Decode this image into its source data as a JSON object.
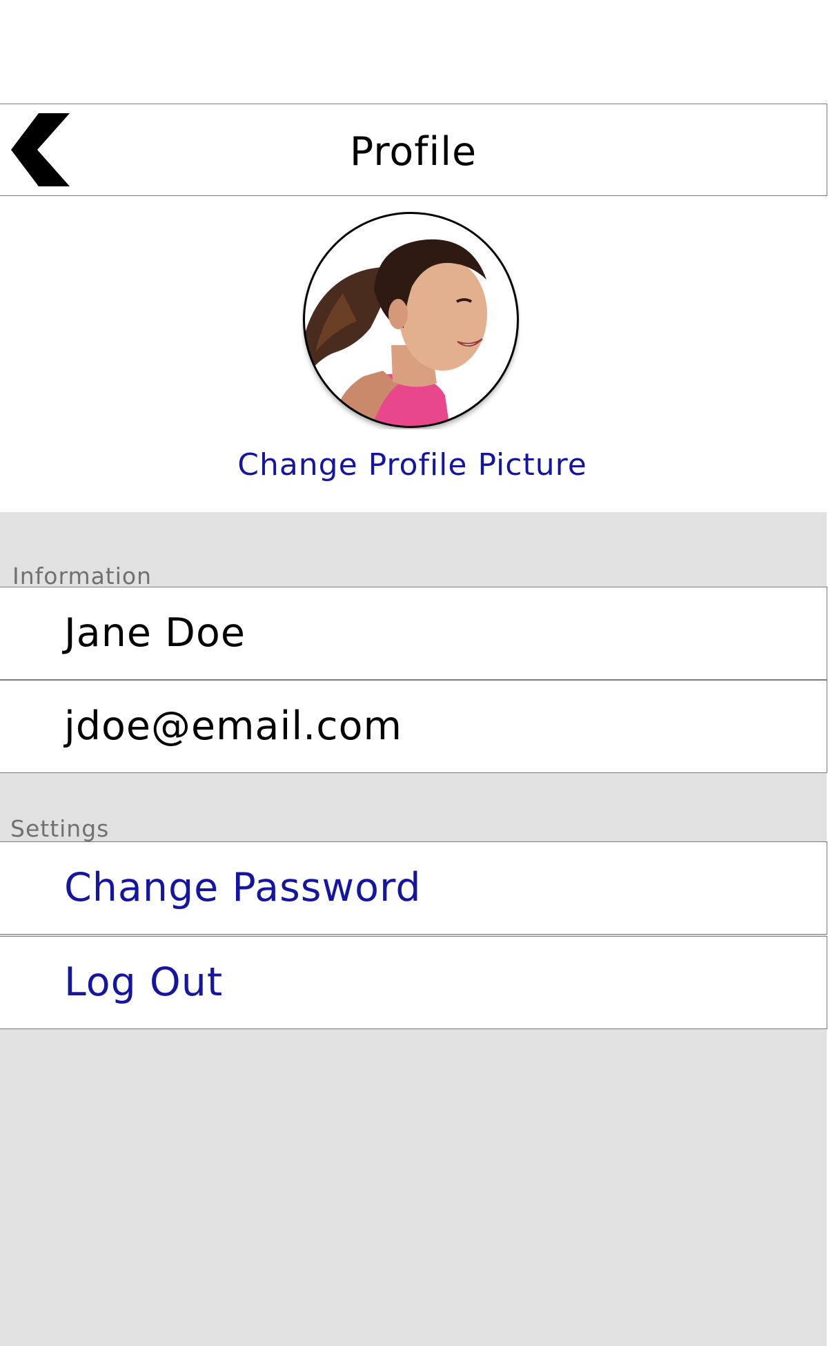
{
  "header": {
    "title": "Profile",
    "back_icon": "chevron-left-icon"
  },
  "profile": {
    "avatar_alt": "profile photo",
    "change_picture_label": "Change Profile Picture"
  },
  "information": {
    "section_label": "Information",
    "name": "Jane Doe",
    "email": "jdoe@email.com"
  },
  "settings": {
    "section_label": "Settings",
    "change_password_label": "Change Password",
    "log_out_label": "Log Out"
  },
  "colors": {
    "link": "#1515a3",
    "background_gray": "#e1e1e1",
    "border": "#7a7a7a",
    "section_label": "#707070"
  }
}
